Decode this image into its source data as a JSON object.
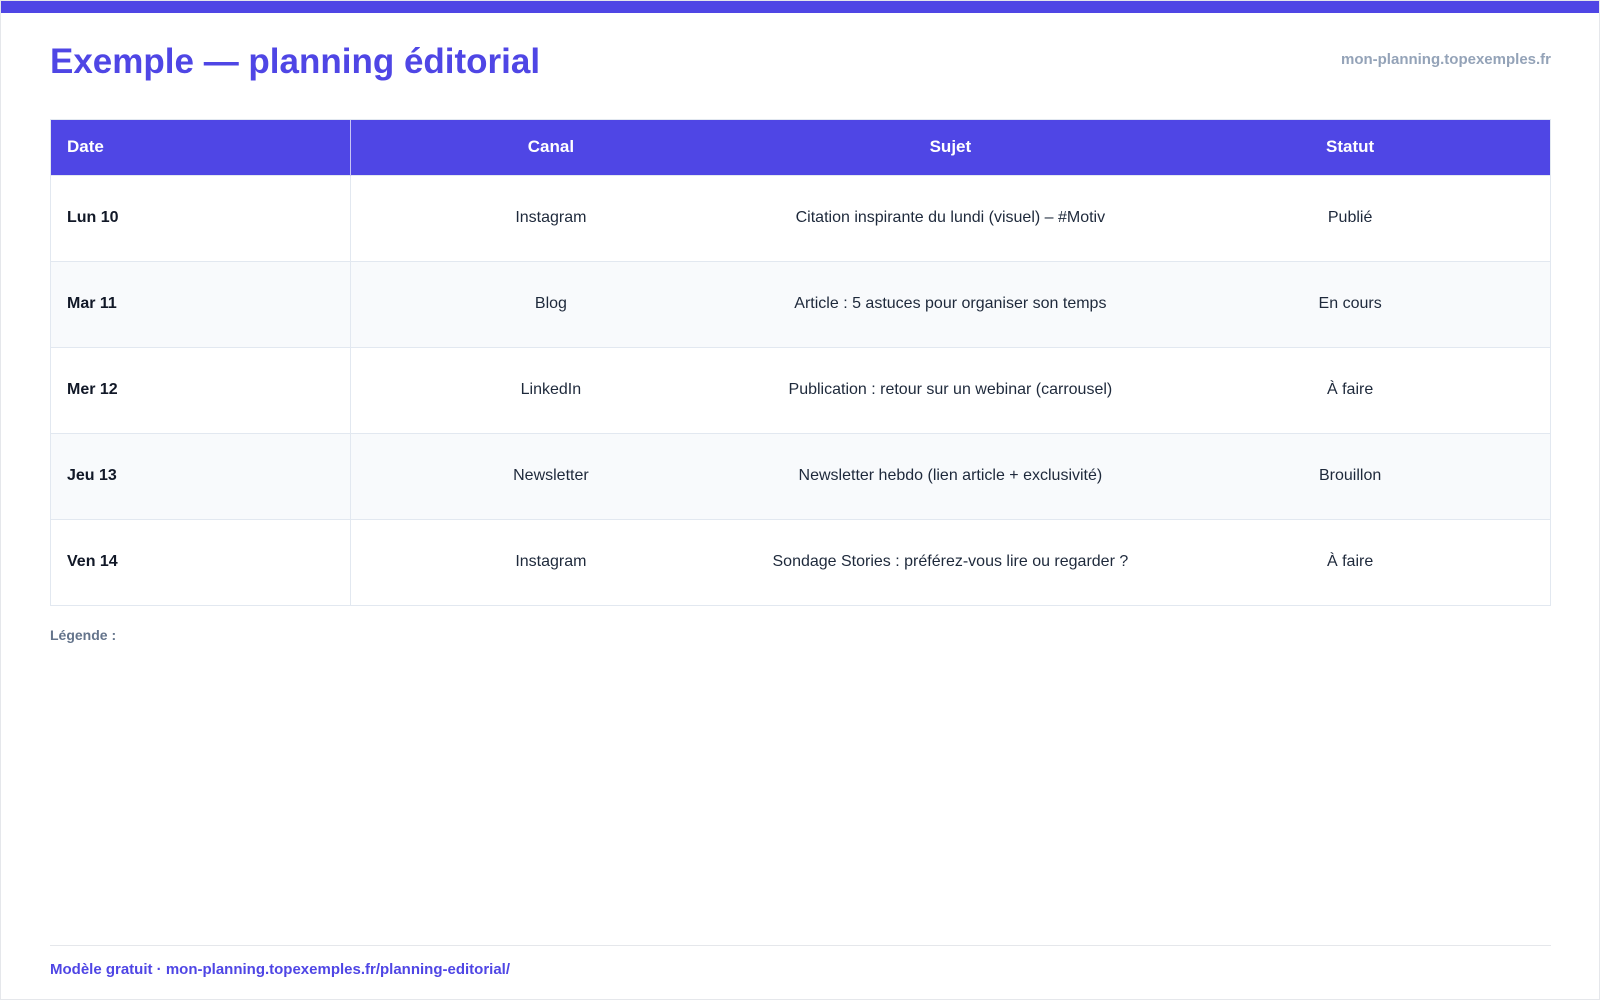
{
  "header": {
    "title": "Exemple — planning éditorial",
    "site": "mon-planning.topexemples.fr"
  },
  "table": {
    "columns": [
      "Date",
      "Canal",
      "Sujet",
      "Statut"
    ],
    "rows": [
      {
        "date": "Lun 10",
        "canal": "Instagram",
        "sujet": "Citation inspirante du lundi (visuel) – #Motiv",
        "statut": "Publié"
      },
      {
        "date": "Mar 11",
        "canal": "Blog",
        "sujet": "Article : 5 astuces pour organiser son temps",
        "statut": "En cours"
      },
      {
        "date": "Mer 12",
        "canal": "LinkedIn",
        "sujet": "Publication : retour sur un webinar (carrousel)",
        "statut": "À faire"
      },
      {
        "date": "Jeu 13",
        "canal": "Newsletter",
        "sujet": "Newsletter hebdo (lien article + exclusivité)",
        "statut": "Brouillon"
      },
      {
        "date": "Ven 14",
        "canal": "Instagram",
        "sujet": "Sondage Stories : préférez-vous lire ou regarder ?",
        "statut": "À faire"
      }
    ]
  },
  "legend": {
    "label": "Légende :"
  },
  "footer": {
    "text": "Modèle gratuit · mon-planning.topexemples.fr/planning-editorial/"
  },
  "colors": {
    "accent": "#4f46e5",
    "muted": "#94a3b8",
    "row_alt": "#f8fafc"
  }
}
